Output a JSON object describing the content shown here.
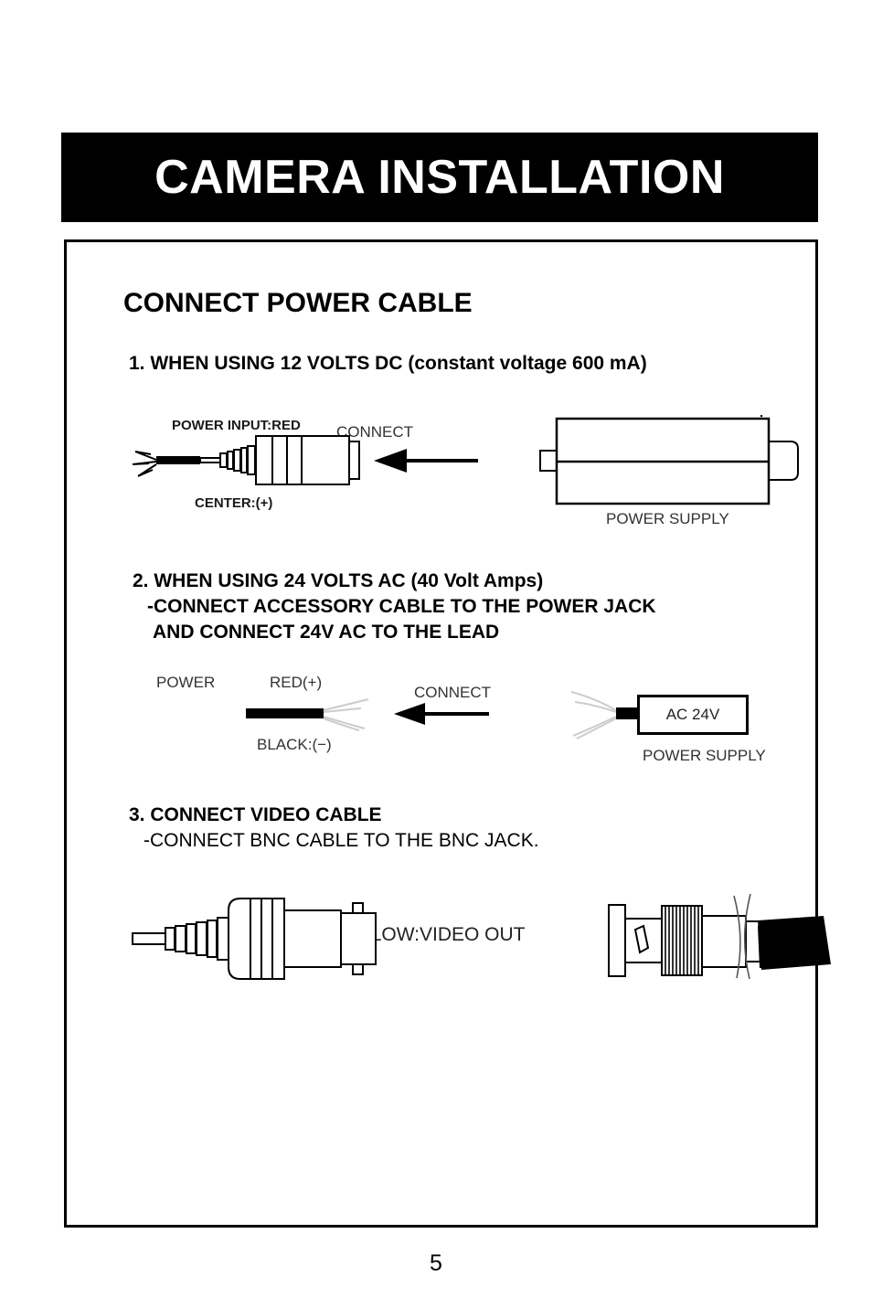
{
  "header": {
    "title": "CAMERA INSTALLATION"
  },
  "content": {
    "section_title": "CONNECT POWER CABLE",
    "steps": [
      {
        "heading": "1. WHEN USING 12 VOLTS DC (constant voltage 600 mA)",
        "diagram": {
          "label_power_input": "POWER INPUT:RED",
          "label_connect": "CONNECT",
          "label_center": "CENTER:(+)",
          "label_power_supply": "POWER SUPPLY"
        }
      },
      {
        "heading": "2. WHEN USING 24 VOLTS AC (40 Volt Amps)",
        "subline_1": "-CONNECT ACCESSORY CABLE TO THE POWER JACK",
        "subline_2": "AND CONNECT 24V AC TO THE LEAD",
        "diagram": {
          "label_power": "POWER",
          "label_red": "RED(+)",
          "label_black": "BLACK:(−)",
          "label_connect": "CONNECT",
          "label_ac_box": "AC 24V",
          "label_power_supply": "POWER SUPPLY"
        }
      },
      {
        "heading": "3. CONNECT VIDEO CABLE",
        "subline_1": "-CONNECT BNC CABLE TO THE BNC JACK.",
        "diagram": {
          "label_yellow": "YELLOW:VIDEO OUT"
        }
      }
    ]
  },
  "footer": {
    "page_number": "5"
  },
  "colors": {
    "ink": "#000000",
    "paper": "#ffffff",
    "banner_bg": "#000000",
    "banner_fg": "#ffffff"
  }
}
